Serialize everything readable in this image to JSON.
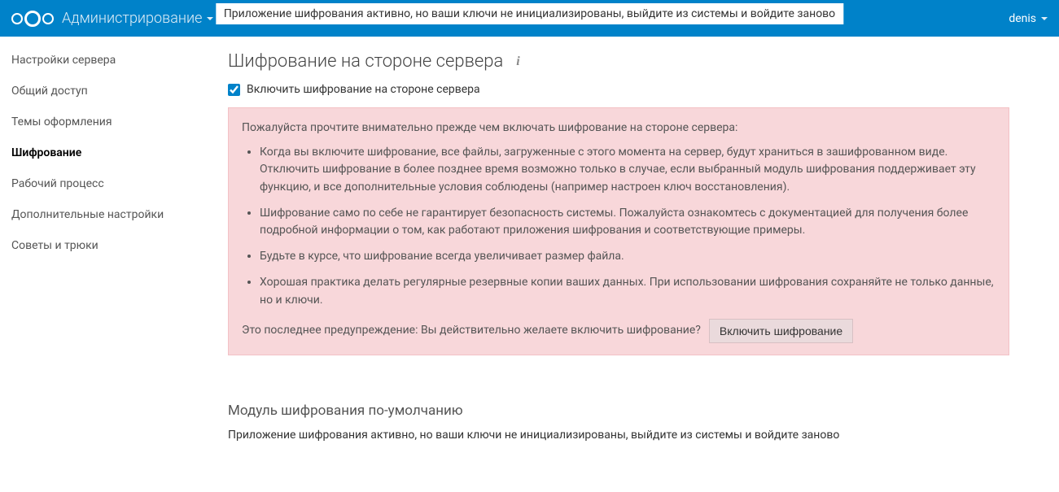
{
  "header": {
    "brand": "Администрирование",
    "banner": "Приложение шифрования активно, но ваши ключи не инициализированы, выйдите из системы и войдите заново",
    "user": "denis"
  },
  "sidebar": {
    "items": [
      {
        "label": "Настройки сервера"
      },
      {
        "label": "Общий доступ"
      },
      {
        "label": "Темы оформления"
      },
      {
        "label": "Шифрование"
      },
      {
        "label": "Рабочий процесс"
      },
      {
        "label": "Дополнительные настройки"
      },
      {
        "label": "Советы и трюки"
      }
    ],
    "active_index": 3
  },
  "main": {
    "title": "Шифрование на стороне сервера",
    "checkbox_label": "Включить шифрование на стороне сервера",
    "checkbox_checked": true,
    "warning": {
      "intro": "Пожалуйста прочтите внимательно прежде чем включать шифрование на стороне сервера:",
      "bullets": [
        "Когда вы включите шифрование, все файлы, загруженные с этого момента на сервер, будут храниться в зашифрованном виде. Отключить шифрование в более позднее время возможно только в случае, если выбранный модуль шифрования поддерживает эту функцию, и все дополнительные условия соблюдены (например настроен ключ восстановления).",
        "Шифрование само по себе не гарантирует безопасность системы. Пожалуйста ознакомтесь с документацией для получения более подробной информации о том, как работают приложения шифрования и соответствующие примеры.",
        "Будьте в курсе, что шифрование всегда увеличивает размер файла.",
        "Хорошая практика делать регулярные резервные копии ваших данных. При использовании шифрования сохраняйте не только данные, но и ключи."
      ],
      "confirm_text": "Это последнее предупреждение: Вы действительно желаете включить шифрование?",
      "confirm_button": "Включить шифрование"
    },
    "module_title": "Модуль шифрования по-умолчанию",
    "module_message": "Приложение шифрования активно, но ваши ключи не инициализированы, выйдите из системы и войдите заново"
  }
}
